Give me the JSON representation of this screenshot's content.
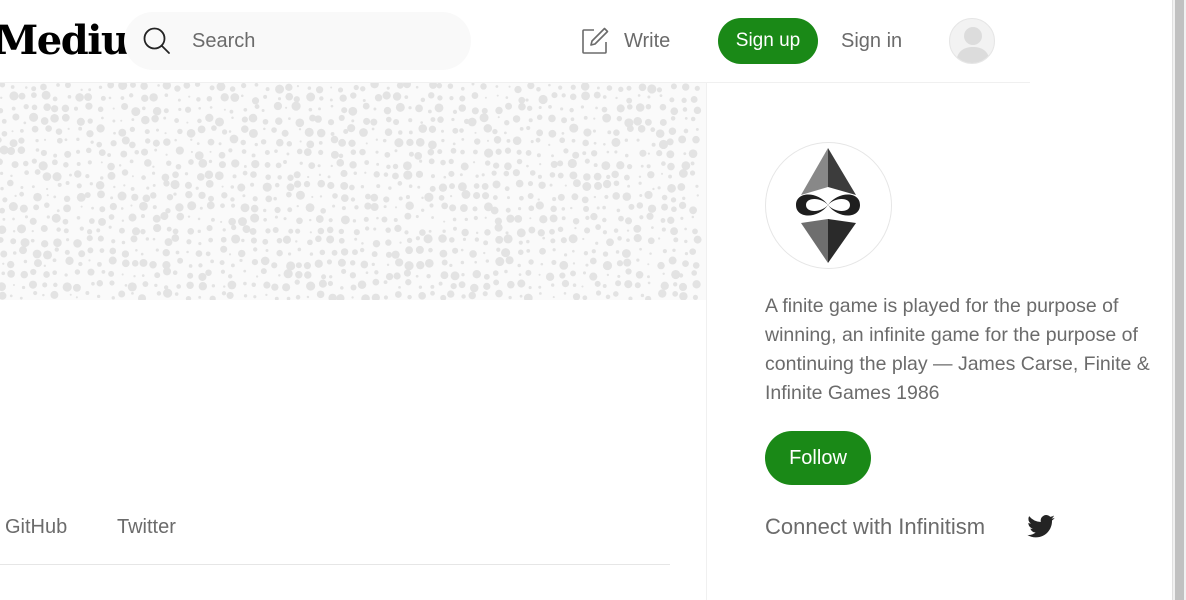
{
  "header": {
    "logo_text": "Medium",
    "search_placeholder": "Search",
    "write_label": "Write",
    "signup_label": "Sign up",
    "signin_label": "Sign in"
  },
  "profile_tabs": [
    "GitHub",
    "Twitter"
  ],
  "sidebar": {
    "bio": "A finite game is played for the purpose of winning, an infinite game for the purpose of continuing the play — James Carse, Finite & Infinite Games 1986",
    "follow_label": "Follow",
    "connect_text": "Connect with Infinitism"
  },
  "colors": {
    "brand_green": "#1a8917",
    "text_secondary": "#6b6b6b",
    "banner_dots": "#e3e3e3"
  }
}
